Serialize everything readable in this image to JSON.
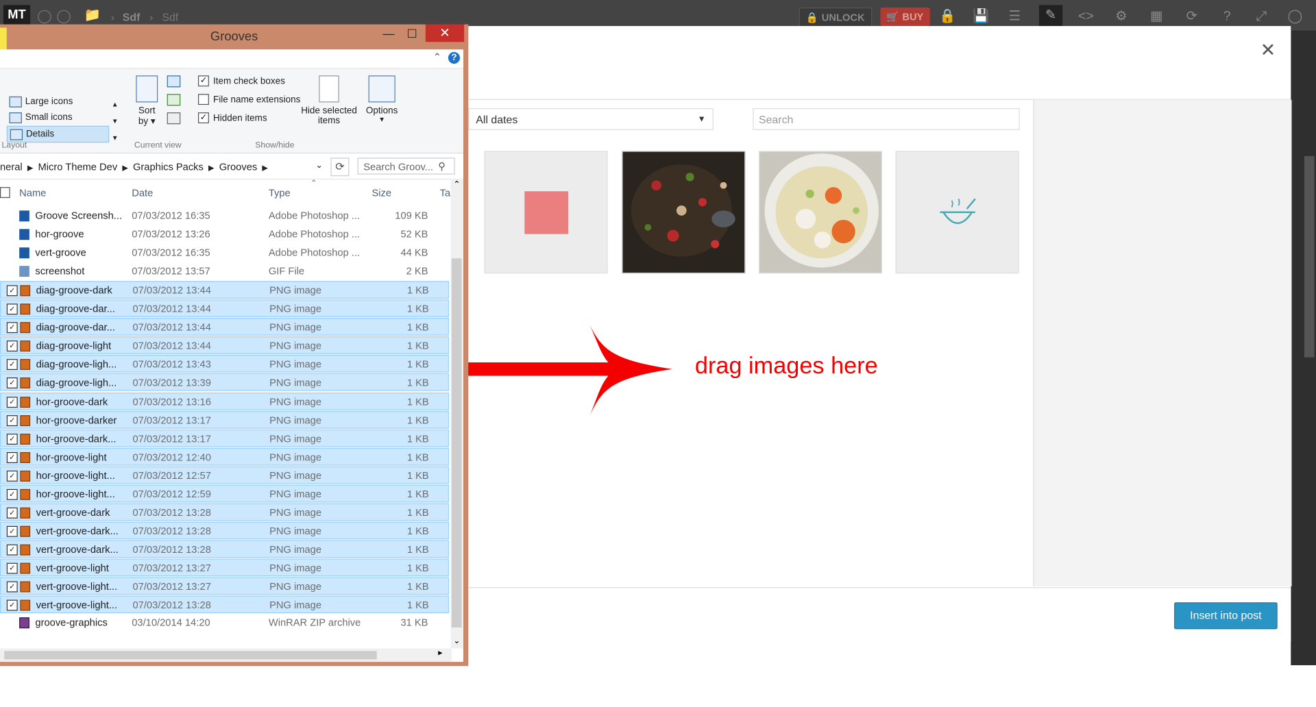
{
  "app": {
    "logo": "MT",
    "breadcrumb": [
      "Sdf",
      "Sdf"
    ],
    "unlock_label": "UNLOCK",
    "buy_label": "BUY",
    "colors": {
      "unlock": "#3a3a3a",
      "buy": "#c0392b",
      "bar": "#444444"
    }
  },
  "explorer": {
    "title": "Grooves",
    "ribbon": {
      "layout_items": [
        "Large icons",
        "Small icons",
        "Details"
      ],
      "layout_selected": "Details",
      "group_layout": "Layout",
      "sort_label": "Sort",
      "sort_label2": "by",
      "group_current_view": "Current view",
      "checkboxes": [
        {
          "label": "Item check boxes",
          "checked": true
        },
        {
          "label": "File name extensions",
          "checked": false
        },
        {
          "label": "Hidden items",
          "checked": true
        }
      ],
      "hide_selected": "Hide selected",
      "hide_selected2": "items",
      "options": "Options",
      "group_show_hide": "Show/hide"
    },
    "address": {
      "path": [
        "neral",
        "Micro Theme Dev",
        "Graphics Packs",
        "Grooves"
      ],
      "search_placeholder": "Search Groov..."
    },
    "columns": {
      "name": "Name",
      "date": "Date",
      "type": "Type",
      "size": "Size",
      "tags": "Ta"
    },
    "rows": [
      {
        "name": "Groove Screensh...",
        "date": "07/03/2012 16:35",
        "type": "Adobe Photoshop ...",
        "size": "109 KB",
        "icon": "photoshop-icon",
        "selected": false
      },
      {
        "name": "hor-groove",
        "date": "07/03/2012 13:26",
        "type": "Adobe Photoshop ...",
        "size": "52 KB",
        "icon": "photoshop-icon",
        "selected": false
      },
      {
        "name": "vert-groove",
        "date": "07/03/2012 16:35",
        "type": "Adobe Photoshop ...",
        "size": "44 KB",
        "icon": "photoshop-icon",
        "selected": false
      },
      {
        "name": "screenshot",
        "date": "07/03/2012 13:57",
        "type": "GIF File",
        "size": "2 KB",
        "icon": "gif-icon",
        "selected": false
      },
      {
        "name": "diag-groove-dark",
        "date": "07/03/2012 13:44",
        "type": "PNG image",
        "size": "1 KB",
        "icon": "png-icon",
        "selected": true
      },
      {
        "name": "diag-groove-dar...",
        "date": "07/03/2012 13:44",
        "type": "PNG image",
        "size": "1 KB",
        "icon": "png-icon",
        "selected": true
      },
      {
        "name": "diag-groove-dar...",
        "date": "07/03/2012 13:44",
        "type": "PNG image",
        "size": "1 KB",
        "icon": "png-icon",
        "selected": true
      },
      {
        "name": "diag-groove-light",
        "date": "07/03/2012 13:44",
        "type": "PNG image",
        "size": "1 KB",
        "icon": "png-icon",
        "selected": true
      },
      {
        "name": "diag-groove-ligh...",
        "date": "07/03/2012 13:43",
        "type": "PNG image",
        "size": "1 KB",
        "icon": "png-icon",
        "selected": true
      },
      {
        "name": "diag-groove-ligh...",
        "date": "07/03/2012 13:39",
        "type": "PNG image",
        "size": "1 KB",
        "icon": "png-icon",
        "selected": true
      },
      {
        "name": "hor-groove-dark",
        "date": "07/03/2012 13:16",
        "type": "PNG image",
        "size": "1 KB",
        "icon": "png-icon",
        "selected": true
      },
      {
        "name": "hor-groove-darker",
        "date": "07/03/2012 13:17",
        "type": "PNG image",
        "size": "1 KB",
        "icon": "png-icon",
        "selected": true
      },
      {
        "name": "hor-groove-dark...",
        "date": "07/03/2012 13:17",
        "type": "PNG image",
        "size": "1 KB",
        "icon": "png-icon",
        "selected": true
      },
      {
        "name": "hor-groove-light",
        "date": "07/03/2012 12:40",
        "type": "PNG image",
        "size": "1 KB",
        "icon": "png-icon",
        "selected": true
      },
      {
        "name": "hor-groove-light...",
        "date": "07/03/2012 12:57",
        "type": "PNG image",
        "size": "1 KB",
        "icon": "png-icon",
        "selected": true
      },
      {
        "name": "hor-groove-light...",
        "date": "07/03/2012 12:59",
        "type": "PNG image",
        "size": "1 KB",
        "icon": "png-icon",
        "selected": true
      },
      {
        "name": "vert-groove-dark",
        "date": "07/03/2012 13:28",
        "type": "PNG image",
        "size": "1 KB",
        "icon": "png-icon",
        "selected": true
      },
      {
        "name": "vert-groove-dark...",
        "date": "07/03/2012 13:28",
        "type": "PNG image",
        "size": "1 KB",
        "icon": "png-icon",
        "selected": true
      },
      {
        "name": "vert-groove-dark...",
        "date": "07/03/2012 13:28",
        "type": "PNG image",
        "size": "1 KB",
        "icon": "png-icon",
        "selected": true
      },
      {
        "name": "vert-groove-light",
        "date": "07/03/2012 13:27",
        "type": "PNG image",
        "size": "1 KB",
        "icon": "png-icon",
        "selected": true
      },
      {
        "name": "vert-groove-light...",
        "date": "07/03/2012 13:27",
        "type": "PNG image",
        "size": "1 KB",
        "icon": "png-icon",
        "selected": true
      },
      {
        "name": "vert-groove-light...",
        "date": "07/03/2012 13:28",
        "type": "PNG image",
        "size": "1 KB",
        "icon": "png-icon",
        "selected": true
      },
      {
        "name": "groove-graphics",
        "date": "03/10/2014 14:20",
        "type": "WinRAR ZIP archive",
        "size": "31 KB",
        "icon": "winrar-icon",
        "selected": false
      }
    ]
  },
  "media": {
    "date_filter": "All dates",
    "search_placeholder": "Search",
    "drag_hint": "drag images here",
    "insert_button": "Insert into post",
    "accent": "#2a95c5",
    "thumbnails": [
      "pink-square-image",
      "stir-fry-photo",
      "soup-bowl-photo",
      "bowl-icon-image"
    ]
  }
}
